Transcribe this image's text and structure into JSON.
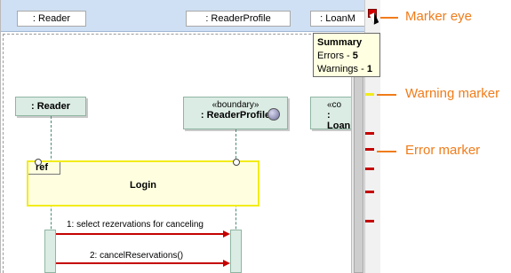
{
  "header_lifelines": [
    ": Reader",
    ": ReaderProfile",
    ": LoanM"
  ],
  "lifelines": [
    {
      "name": ": Reader",
      "stereotype": ""
    },
    {
      "name": ": ReaderProfile",
      "stereotype": "«boundary»"
    },
    {
      "name": ": LoanM",
      "stereotype": "«co"
    }
  ],
  "ref": {
    "tag": "ref",
    "title": "Login"
  },
  "messages": [
    {
      "label": "1: select rezervations for canceling"
    },
    {
      "label": "2: cancelReservations()"
    }
  ],
  "summary": {
    "title": "Summary",
    "errors_label": "Errors - ",
    "errors_value": "5",
    "warnings_label": "Warnings - ",
    "warnings_value": "1"
  },
  "callouts": {
    "marker_eye": "Marker eye",
    "warning_marker": "Warning marker",
    "error_marker": "Error marker"
  },
  "colors": {
    "error": "#d40000",
    "warning": "#f2ec1a",
    "callout": "#f07c1a",
    "lifeline_fill": "#dbece4"
  }
}
